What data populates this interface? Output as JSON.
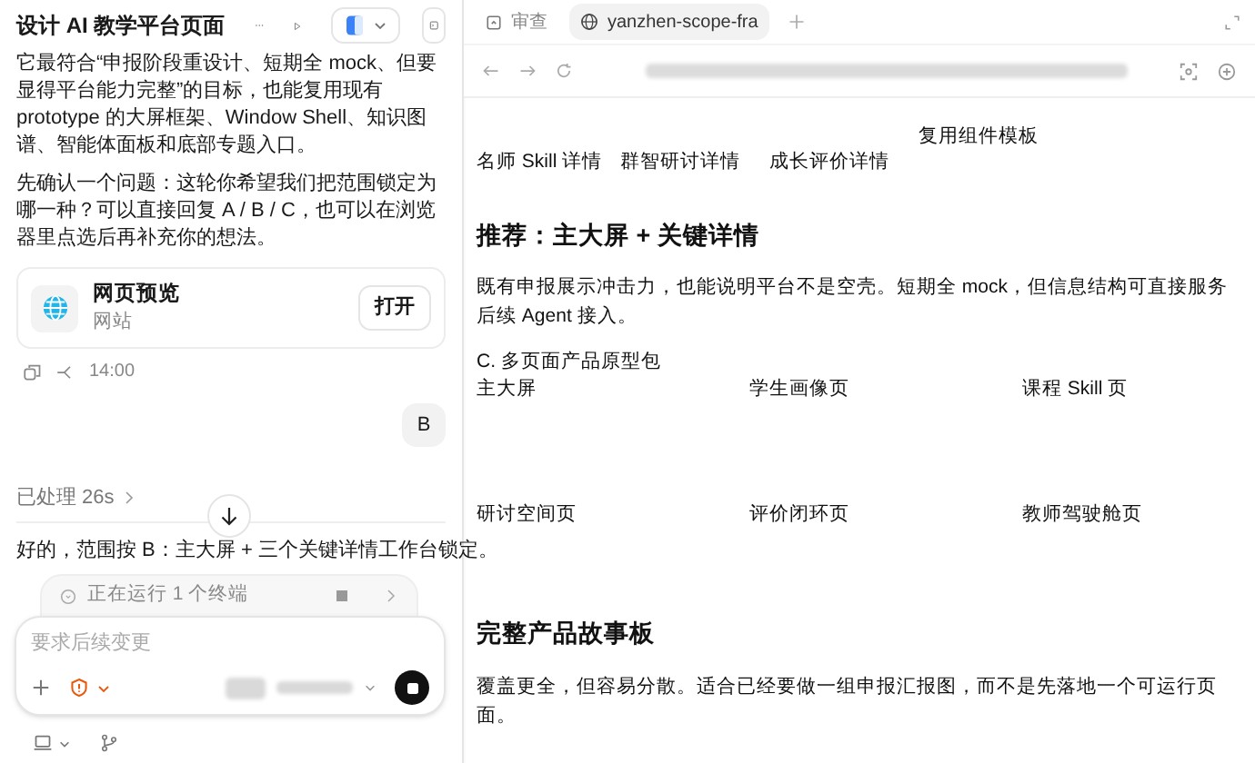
{
  "chat": {
    "title": "设计 AI 教学平台页面",
    "paragraphs": [
      "它最符合“申报阶段重设计、短期全 mock、但要显得平台能力完整”的目标，也能复用现有 prototype 的大屏框架、Window Shell、知识图谱、智能体面板和底部专题入口。",
      "先确认一个问题：这轮你希望我们把范围锁定为哪一种？可以直接回复 A / B / C，也可以在浏览器里点选后再补充你的想法。"
    ],
    "preview_card": {
      "title": "网页预览",
      "subtitle": "网站",
      "button": "打开"
    },
    "time": "14:00",
    "user_message": "B",
    "processed": "已处理 26s",
    "reply": "好的，范围按 B：主大屏 + 三个关键详情工作台锁定。",
    "terminal_status": "正在运行 1 个终端",
    "composer": {
      "placeholder": "要求后续变更"
    }
  },
  "browser": {
    "tabs": [
      {
        "label": "审查",
        "selected": false
      },
      {
        "label": "yanzhen-scope-fra",
        "selected": true
      }
    ]
  },
  "page": {
    "links": [
      "名师 Skill 详情",
      "群智研讨详情",
      "成长评价详情",
      "复用组件模板"
    ],
    "heading": "推荐：主大屏 + 关键详情",
    "description": "既有申报展示冲击力，也能说明平台不是空壳。短期全 mock，但信息结构可直接服务后续 Agent 接入。",
    "option_c": "C. 多页面产品原型包",
    "pages": [
      "主大屏",
      "学生画像页",
      "课程 Skill 页",
      "研讨空间页",
      "评价闭环页",
      "教师驾驶舱页"
    ],
    "heading2": "完整产品故事板",
    "description2": "覆盖更全，但容易分散。适合已经要做一组申报汇报图，而不是先落地一个可运行页面。"
  }
}
